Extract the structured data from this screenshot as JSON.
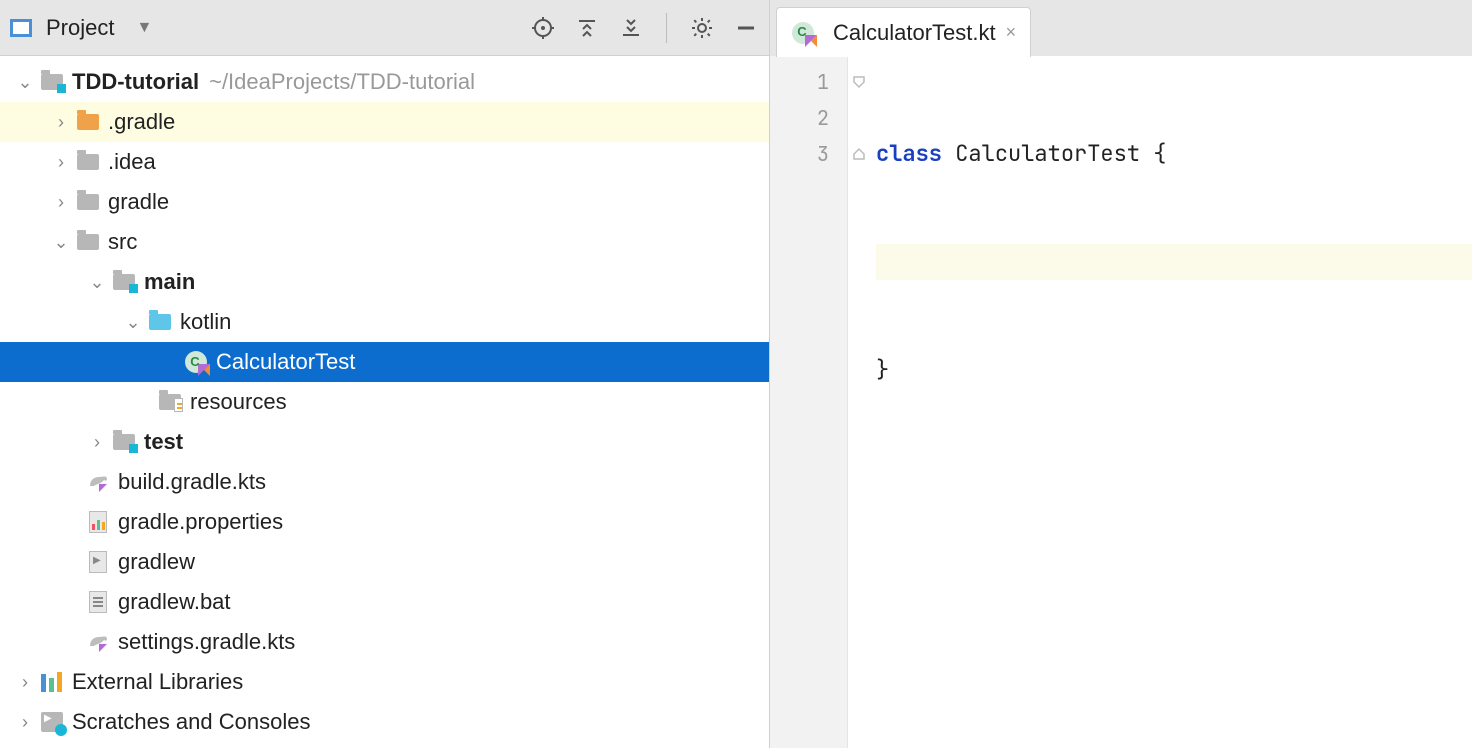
{
  "project_panel": {
    "title": "Project",
    "tree": {
      "root": {
        "label": "TDD-tutorial",
        "path_hint": "~/IdeaProjects/TDD-tutorial"
      },
      "gradle_hidden": ".gradle",
      "idea": ".idea",
      "gradle": "gradle",
      "src": "src",
      "main": "main",
      "kotlin": "kotlin",
      "calc_test": "CalculatorTest",
      "resources": "resources",
      "test": "test",
      "build_gradle": "build.gradle.kts",
      "gradle_props": "gradle.properties",
      "gradlew": "gradlew",
      "gradlew_bat": "gradlew.bat",
      "settings_gradle": "settings.gradle.kts",
      "ext_libs": "External Libraries",
      "scratches": "Scratches and Consoles"
    }
  },
  "editor": {
    "tab_label": "CalculatorTest.kt",
    "lines": {
      "n1": "1",
      "n2": "2",
      "n3": "3"
    },
    "code": {
      "kw_class": "class",
      "line1_rest": " CalculatorTest {",
      "line2": "",
      "line3": "}"
    }
  }
}
